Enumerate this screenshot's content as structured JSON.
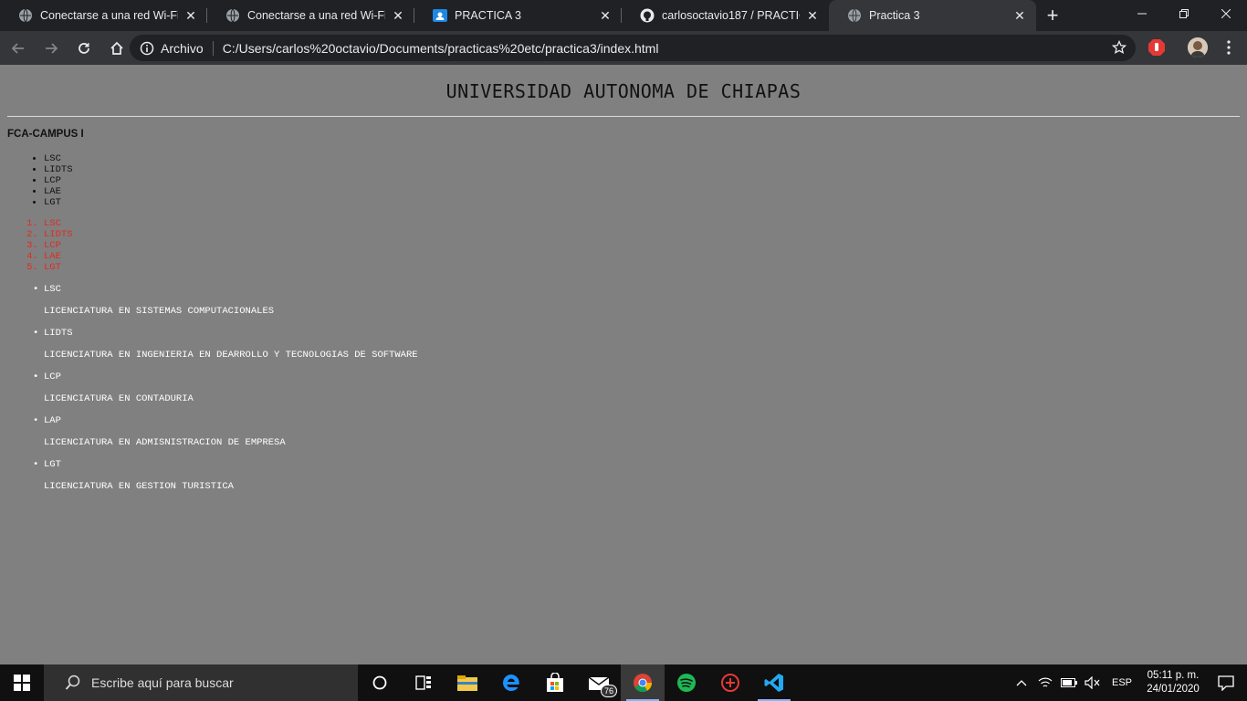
{
  "tabs": [
    {
      "title": "Conectarse a una red Wi-Fi",
      "icon": "globe-icon",
      "active": false
    },
    {
      "title": "Conectarse a una red Wi-Fi",
      "icon": "globe-icon",
      "active": false
    },
    {
      "title": "PRACTICA 3",
      "icon": "classroom-icon",
      "active": false
    },
    {
      "title": "carlosoctavio187 / PRACTICA-3",
      "icon": "github-icon",
      "active": false
    },
    {
      "title": "Practica 3",
      "icon": "globe-icon",
      "active": true
    }
  ],
  "omnibox": {
    "scheme_label": "Archivo",
    "url": "C:/Users/carlos%20octavio/Documents/practicas%20etc/practica3/index.html"
  },
  "page": {
    "heading": "UNIVERSIDAD AUTONOMA DE CHIAPAS",
    "subheading": "FCA-CAMPUS I",
    "unordered_list": [
      "LSC",
      "LIDTS",
      "LCP",
      "LAE",
      "LGT"
    ],
    "ordered_list": [
      "LSC",
      "LIDTS",
      "LCP",
      "LAE",
      "LGT"
    ],
    "definitions": [
      {
        "term": "LSC",
        "description": "LICENCIATURA EN SISTEMAS COMPUTACIONALES"
      },
      {
        "term": "LIDTS",
        "description": "LICENCIATURA EN INGENIERIA EN DEARROLLO Y TECNOLOGIAS DE SOFTWARE"
      },
      {
        "term": "LCP",
        "description": "LICENCIATURA EN CONTADURIA"
      },
      {
        "term": "LAP",
        "description": "LICENCIATURA EN ADMISNISTRACION DE EMPRESA"
      },
      {
        "term": "LGT",
        "description": "LICENCIATURA EN GESTION TURISTICA"
      }
    ],
    "ordered_list_color": "#e02b20"
  },
  "taskbar": {
    "search_placeholder": "Escribe aquí para buscar",
    "mail_badge": "76",
    "language": "ESP",
    "time": "05:11 p. m.",
    "date": "24/01/2020"
  }
}
